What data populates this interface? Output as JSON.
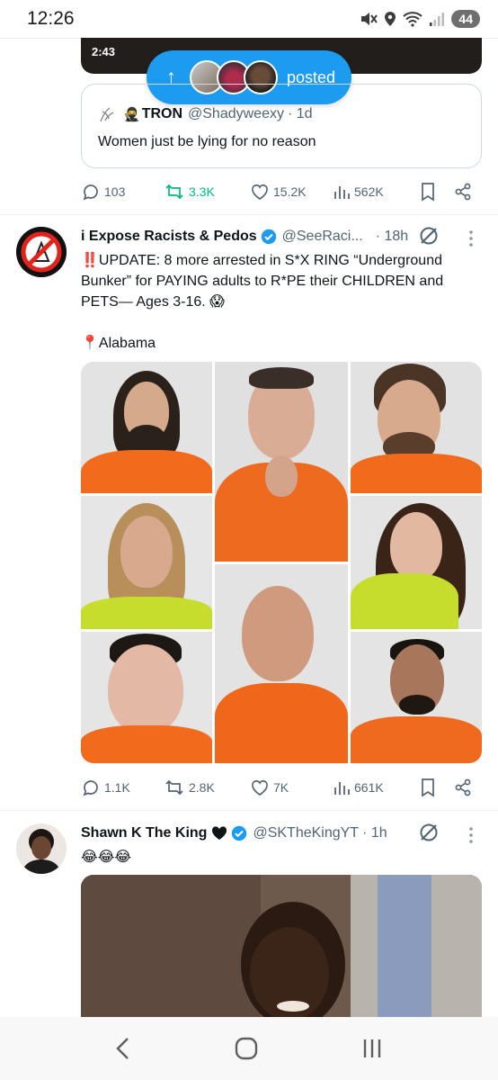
{
  "status_bar": {
    "time": "12:26",
    "battery": "44"
  },
  "video": {
    "duration": "2:43"
  },
  "new_posts_pill": {
    "label": "posted"
  },
  "quote": {
    "emoji": "🥷",
    "name": "TRON",
    "handle": "@Shadyweexy",
    "time": "· 1d",
    "text": "Women just be lying for no reason"
  },
  "tweet1_actions": {
    "replies": "103",
    "reposts": "3.3K",
    "likes": "15.2K",
    "views": "562K"
  },
  "tweet2": {
    "name": "i Expose Racists & Pedos",
    "handle": "@SeeRaci...",
    "time": "· 18h",
    "line1": "‼️UPDATE: 8 more arrested in S*X RING “Underground",
    "line2": "Bunker” for PAYING adults to R*PE their CHILDREN and",
    "line3": "PETS— Ages 3-16. 😱",
    "location": "📍Alabama",
    "replies": "1.1K",
    "reposts": "2.8K",
    "likes": "7K",
    "views": "661K"
  },
  "tweet3": {
    "name": "Shawn K The King",
    "handle": "@SKTheKingYT",
    "time": "· 1h",
    "text": "😂😂😂"
  },
  "colors": {
    "accent": "#1d9bf0",
    "repost_green": "#00ba7c",
    "muted": "#536471",
    "prison_orange": "#f26a1b",
    "prison_yellow": "#c7dd2e"
  },
  "icons": [
    "mute-icon",
    "location-icon",
    "wifi-icon",
    "signal-icon",
    "arrow-up-icon",
    "reply-icon",
    "repost-icon",
    "like-icon",
    "views-icon",
    "bookmark-icon",
    "share-icon",
    "verified-icon",
    "grok-icon",
    "more-icon",
    "back-icon",
    "home-icon",
    "recents-icon"
  ]
}
